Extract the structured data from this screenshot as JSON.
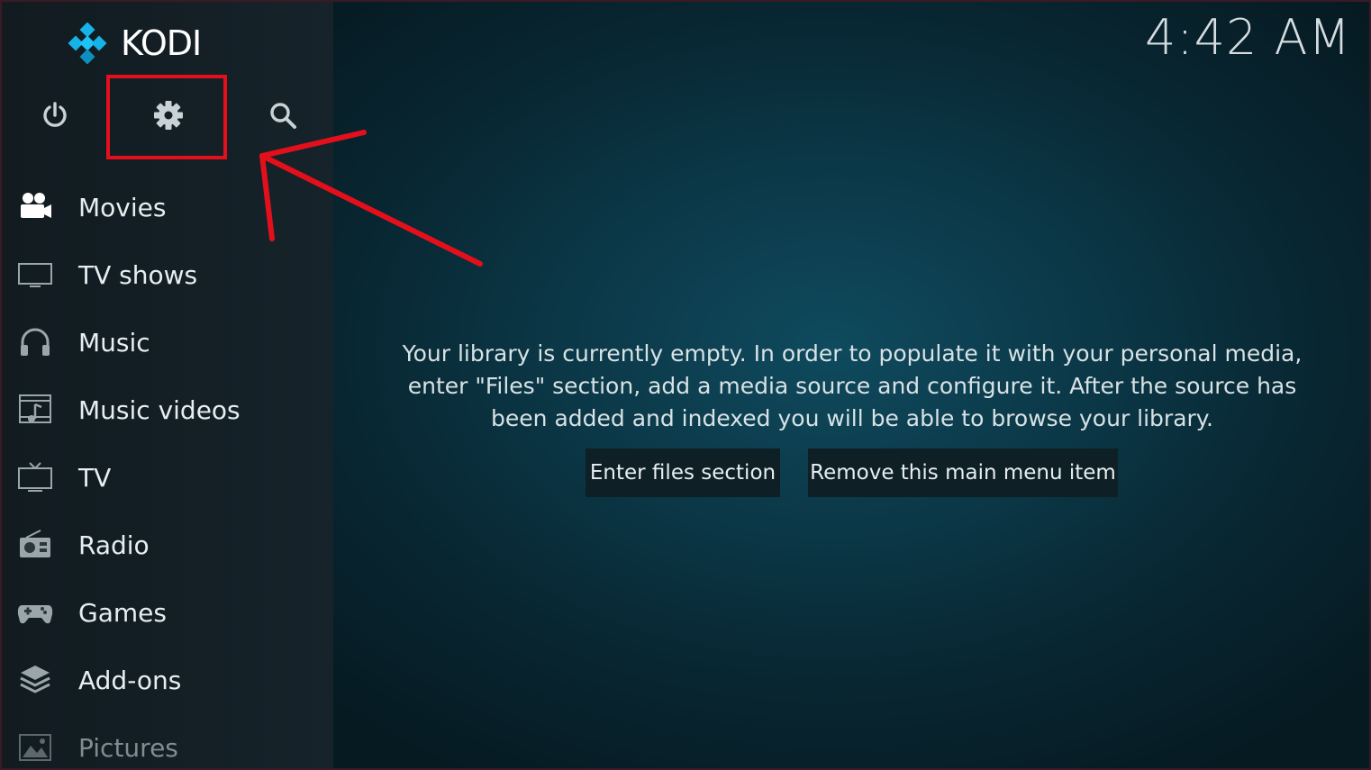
{
  "app": {
    "name": "KODI"
  },
  "header": {
    "clock": "4:42 AM"
  },
  "top_controls": [
    {
      "icon": "power-icon"
    },
    {
      "icon": "gear-icon"
    },
    {
      "icon": "search-icon"
    }
  ],
  "sidebar": {
    "items": [
      {
        "label": "Movies",
        "icon": "movie-camera-icon"
      },
      {
        "label": "TV shows",
        "icon": "monitor-icon"
      },
      {
        "label": "Music",
        "icon": "headphones-icon"
      },
      {
        "label": "Music videos",
        "icon": "music-video-icon"
      },
      {
        "label": "TV",
        "icon": "tv-icon"
      },
      {
        "label": "Radio",
        "icon": "radio-icon"
      },
      {
        "label": "Games",
        "icon": "gamepad-icon"
      },
      {
        "label": "Add-ons",
        "icon": "addons-box-icon"
      },
      {
        "label": "Pictures",
        "icon": "pictures-icon"
      }
    ]
  },
  "main": {
    "empty_message": "Your library is currently empty. In order to populate it with your personal media, enter \"Files\" section, add a media source and configure it. After the source has been added and indexed you will be able to browse your library.",
    "buttons": {
      "enter_files": "Enter files section",
      "remove_item": "Remove this main menu item"
    }
  },
  "annotation": {
    "color": "#e3101c"
  },
  "colors": {
    "accent": "#17b2e7",
    "annotation": "#e3101c"
  }
}
